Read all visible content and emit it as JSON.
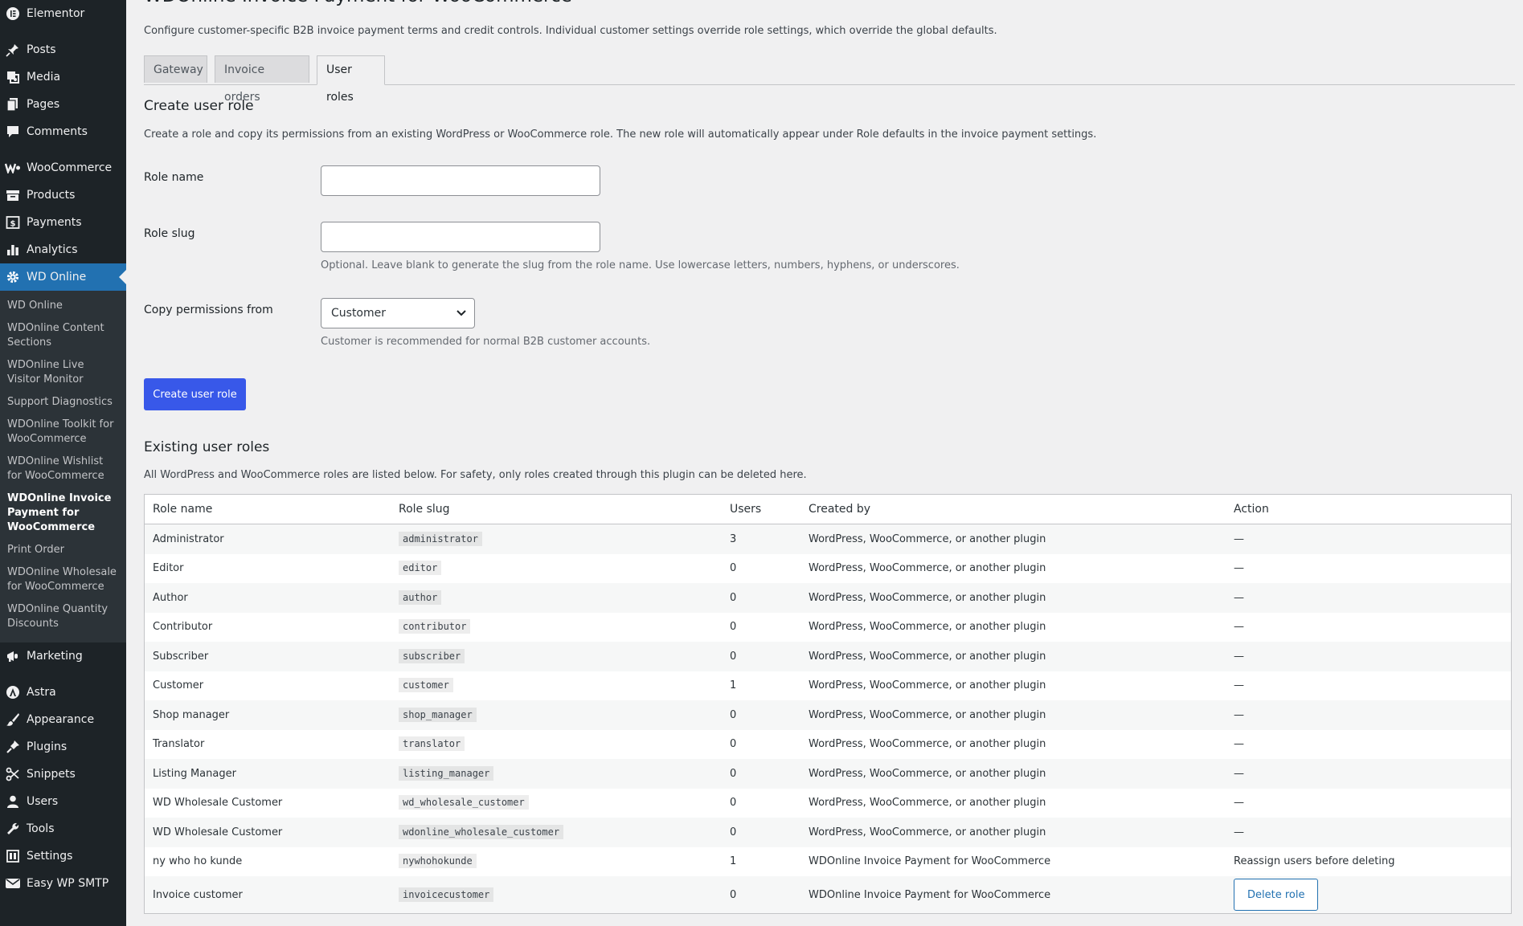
{
  "sidebar": {
    "top_items": [
      {
        "label": "Elementor",
        "icon": "elementor-icon"
      },
      {
        "label": "Posts",
        "icon": "pin-icon"
      },
      {
        "label": "Media",
        "icon": "media-icon"
      },
      {
        "label": "Pages",
        "icon": "pages-icon"
      },
      {
        "label": "Comments",
        "icon": "comment-icon"
      },
      {
        "label": "WooCommerce",
        "icon": "woocommerce-icon"
      },
      {
        "label": "Products",
        "icon": "products-icon"
      },
      {
        "label": "Payments",
        "icon": "payments-icon"
      },
      {
        "label": "Analytics",
        "icon": "analytics-icon"
      },
      {
        "label": "WD Online",
        "icon": "gear-icon"
      }
    ],
    "submenu": [
      "WD Online",
      "WDOnline Content Sections",
      "WDOnline Live Visitor Monitor",
      "Support Diagnostics",
      "WDOnline Toolkit for WooCommerce",
      "WDOnline Wishlist for WooCommerce",
      "WDOnline Invoice Payment for WooCommerce",
      "Print Order",
      "WDOnline Wholesale for WooCommerce",
      "WDOnline Quantity Discounts"
    ],
    "bottom_items": [
      {
        "label": "Marketing",
        "icon": "megaphone-icon"
      },
      {
        "label": "Astra",
        "icon": "astra-icon"
      },
      {
        "label": "Appearance",
        "icon": "brush-icon"
      },
      {
        "label": "Plugins",
        "icon": "plugin-icon"
      },
      {
        "label": "Snippets",
        "icon": "snippets-icon"
      },
      {
        "label": "Users",
        "icon": "user-icon"
      },
      {
        "label": "Tools",
        "icon": "wrench-icon"
      },
      {
        "label": "Settings",
        "icon": "settings-icon"
      },
      {
        "label": "Easy WP SMTP",
        "icon": "smtp-icon"
      }
    ]
  },
  "page": {
    "title": "WDOnline Invoice Payment for WooCommerce",
    "intro": "Configure customer-specific B2B invoice payment terms and credit controls. Individual customer settings override role settings, which override the global defaults.",
    "tabs": [
      "Gateway",
      "Invoice orders",
      "User roles"
    ]
  },
  "create": {
    "heading": "Create user role",
    "description": "Create a role and copy its permissions from an existing WordPress or WooCommerce role. The new role will automatically appear under Role defaults in the invoice payment settings.",
    "role_name_label": "Role name",
    "role_name_value": "",
    "role_slug_label": "Role slug",
    "role_slug_value": "",
    "role_slug_help": "Optional. Leave blank to generate the slug from the role name. Use lowercase letters, numbers, hyphens, or underscores.",
    "copy_label": "Copy permissions from",
    "copy_value": "Customer",
    "copy_help": "Customer is recommended for normal B2B customer accounts.",
    "submit_label": "Create user role"
  },
  "existing": {
    "heading": "Existing user roles",
    "description": "All WordPress and WooCommerce roles are listed below. For safety, only roles created through this plugin can be deleted here.",
    "columns": [
      "Role name",
      "Role slug",
      "Users",
      "Created by",
      "Action"
    ],
    "rows": [
      {
        "name": "Administrator",
        "slug": "administrator",
        "users": "3",
        "created_by": "WordPress, WooCommerce, or another plugin",
        "action": "—"
      },
      {
        "name": "Editor",
        "slug": "editor",
        "users": "0",
        "created_by": "WordPress, WooCommerce, or another plugin",
        "action": "—"
      },
      {
        "name": "Author",
        "slug": "author",
        "users": "0",
        "created_by": "WordPress, WooCommerce, or another plugin",
        "action": "—"
      },
      {
        "name": "Contributor",
        "slug": "contributor",
        "users": "0",
        "created_by": "WordPress, WooCommerce, or another plugin",
        "action": "—"
      },
      {
        "name": "Subscriber",
        "slug": "subscriber",
        "users": "0",
        "created_by": "WordPress, WooCommerce, or another plugin",
        "action": "—"
      },
      {
        "name": "Customer",
        "slug": "customer",
        "users": "1",
        "created_by": "WordPress, WooCommerce, or another plugin",
        "action": "—"
      },
      {
        "name": "Shop manager",
        "slug": "shop_manager",
        "users": "0",
        "created_by": "WordPress, WooCommerce, or another plugin",
        "action": "—"
      },
      {
        "name": "Translator",
        "slug": "translator",
        "users": "0",
        "created_by": "WordPress, WooCommerce, or another plugin",
        "action": "—"
      },
      {
        "name": "Listing Manager",
        "slug": "listing_manager",
        "users": "0",
        "created_by": "WordPress, WooCommerce, or another plugin",
        "action": "—"
      },
      {
        "name": "WD Wholesale Customer",
        "slug": "wd_wholesale_customer",
        "users": "0",
        "created_by": "WordPress, WooCommerce, or another plugin",
        "action": "—"
      },
      {
        "name": "WD Wholesale Customer",
        "slug": "wdonline_wholesale_customer",
        "users": "0",
        "created_by": "WordPress, WooCommerce, or another plugin",
        "action": "—"
      },
      {
        "name": "ny who ho kunde",
        "slug": "nywhohokunde",
        "users": "1",
        "created_by": "WDOnline Invoice Payment for WooCommerce",
        "action": "Reassign users before deleting"
      },
      {
        "name": "Invoice customer",
        "slug": "invoicecustomer",
        "users": "0",
        "created_by": "WDOnline Invoice Payment for WooCommerce",
        "action": "",
        "button": "Delete role"
      }
    ]
  },
  "colors": {
    "sidebar_bg": "#1d2327",
    "active_bg": "#2271b1",
    "primary": "#3858e9"
  }
}
